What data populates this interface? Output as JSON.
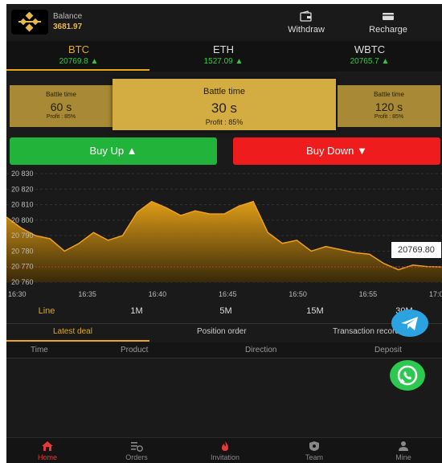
{
  "header": {
    "balance_label": "Balance",
    "balance_value": "3681.97",
    "withdraw_label": "Withdraw",
    "recharge_label": "Recharge"
  },
  "coins": [
    {
      "name": "BTC",
      "price": "20769.8 ▲"
    },
    {
      "name": "ETH",
      "price": "1527.09 ▲"
    },
    {
      "name": "WBTC",
      "price": "20765.7 ▲"
    }
  ],
  "battle": [
    {
      "label": "Battle time",
      "value": "60 s",
      "profit": "Profit : 85%"
    },
    {
      "label": "Battle time",
      "value": "30 s",
      "profit": "Profit : 85%"
    },
    {
      "label": "Battle time",
      "value": "120 s",
      "profit": "Profit : 85%"
    }
  ],
  "actions": {
    "buy_up": "Buy Up ▲",
    "buy_down": "Buy Down ▼"
  },
  "chart_data": {
    "type": "area",
    "yticks": [
      "20 830",
      "20 820",
      "20 810",
      "20 800",
      "20 790",
      "20 780",
      "20 770",
      "20 760"
    ],
    "ylim": [
      20760,
      20830
    ],
    "xticks": [
      "16:30",
      "16:35",
      "16:40",
      "16:45",
      "16:50",
      "16:55",
      "17:00"
    ],
    "x": [
      "16:30",
      "16:31",
      "16:32",
      "16:33",
      "16:34",
      "16:35",
      "16:36",
      "16:37",
      "16:38",
      "16:39",
      "16:40",
      "16:41",
      "16:42",
      "16:43",
      "16:44",
      "16:45",
      "16:46",
      "16:47",
      "16:48",
      "16:49",
      "16:50",
      "16:51",
      "16:52",
      "16:53",
      "16:54",
      "16:55",
      "16:56",
      "16:57",
      "16:58",
      "16:59",
      "17:00"
    ],
    "values": [
      20802,
      20795,
      20790,
      20788,
      20780,
      20785,
      20792,
      20787,
      20790,
      20805,
      20812,
      20808,
      20803,
      20806,
      20804,
      20804,
      20809,
      20812,
      20792,
      20785,
      20787,
      20780,
      20783,
      20781,
      20779,
      20778,
      20772,
      20768,
      20771,
      20770,
      20769.8
    ],
    "current_price": "20769.80",
    "colors": {
      "line": "#f0a020",
      "fill_top": "#e8a317",
      "fill_bottom": "#3a2a08"
    }
  },
  "periods": [
    "Line",
    "1M",
    "5M",
    "15M",
    "30M"
  ],
  "list_tabs": [
    "Latest deal",
    "Position order",
    "Transaction records"
  ],
  "table_headers": [
    "Time",
    "Product",
    "Direction",
    "Deposit"
  ],
  "nav": [
    "Home",
    "Orders",
    "Invitation",
    "Team",
    "Mine"
  ],
  "colors": {
    "accent": "#e6a817",
    "up": "#22b33a",
    "down": "#ee1c1c"
  }
}
